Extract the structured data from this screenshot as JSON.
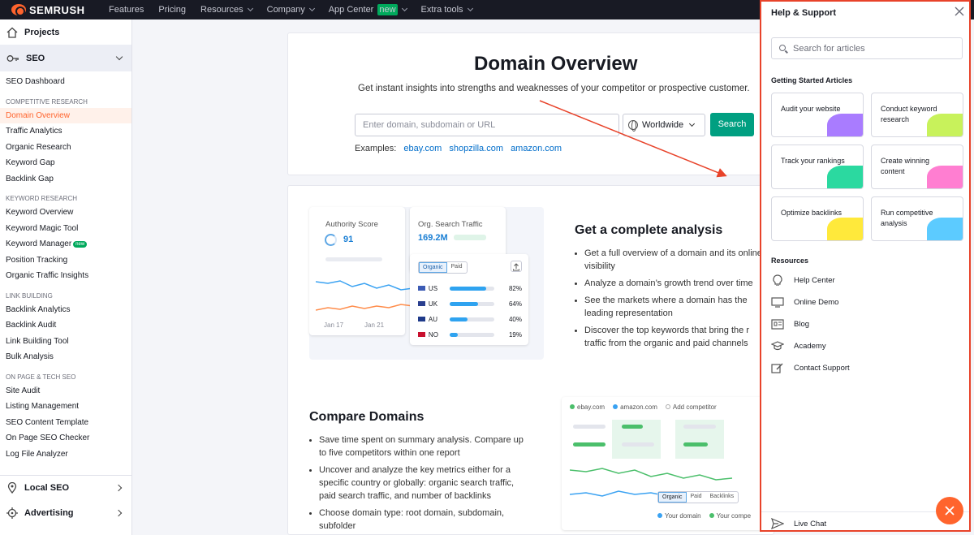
{
  "topbar": {
    "logo": "SEMRUSH",
    "nav": [
      {
        "label": "Features",
        "has_menu": false,
        "is_new": false
      },
      {
        "label": "Pricing",
        "has_menu": false,
        "is_new": false
      },
      {
        "label": "Resources",
        "has_menu": true,
        "is_new": false
      },
      {
        "label": "Company",
        "has_menu": true,
        "is_new": false
      },
      {
        "label": "App Center",
        "has_menu": true,
        "is_new": true
      },
      {
        "label": "Extra tools",
        "has_menu": true,
        "is_new": false
      }
    ],
    "new_badge": "new"
  },
  "sidebar": {
    "projects": "Projects",
    "seo": "SEO",
    "dashboard": "SEO Dashboard",
    "sections": [
      {
        "title": "COMPETITIVE RESEARCH",
        "items": [
          "Domain Overview",
          "Traffic Analytics",
          "Organic Research",
          "Keyword Gap",
          "Backlink Gap"
        ]
      },
      {
        "title": "KEYWORD RESEARCH",
        "items": [
          "Keyword Overview",
          "Keyword Magic Tool",
          "Keyword Manager",
          "Position Tracking",
          "Organic Traffic Insights"
        ]
      },
      {
        "title": "LINK BUILDING",
        "items": [
          "Backlink Analytics",
          "Backlink Audit",
          "Link Building Tool",
          "Bulk Analysis"
        ]
      },
      {
        "title": "ON PAGE & TECH SEO",
        "items": [
          "Site Audit",
          "Listing Management",
          "SEO Content Template",
          "On Page SEO Checker",
          "Log File Analyzer"
        ]
      }
    ],
    "new_badge": "new",
    "local_seo": "Local SEO",
    "advertising": "Advertising"
  },
  "hero": {
    "title": "Domain Overview",
    "subtitle": "Get instant insights into strengths and weaknesses of your competitor or prospective customer.",
    "placeholder": "Enter domain, subdomain or URL",
    "region": "Worldwide",
    "search": "Search",
    "examples_label": "Examples:",
    "examples": [
      "ebay.com",
      "shopzilla.com",
      "amazon.com"
    ]
  },
  "illustration": {
    "authority_label": "Authority Score",
    "authority_value": "91",
    "traffic_label": "Org. Search Traffic",
    "traffic_value": "169.2M",
    "dates": [
      "Jan 17",
      "Jan 21"
    ],
    "tabs": [
      "Organic",
      "Paid"
    ],
    "countries": [
      {
        "code": "US",
        "pct": "82%",
        "value": 82
      },
      {
        "code": "UK",
        "pct": "64%",
        "value": 64
      },
      {
        "code": "AU",
        "pct": "40%",
        "value": 40
      },
      {
        "code": "NO",
        "pct": "19%",
        "value": 19
      }
    ]
  },
  "analysis": {
    "title": "Get a complete analysis",
    "bullets": [
      "Get a full overview of a domain and its online visibility",
      "Analyze a domain’s growth trend over time",
      "See the markets where a domain has the leading representation",
      "Discover the top keywords that bring the r traffic from the organic and paid channels"
    ]
  },
  "compare": {
    "title": "Compare Domains",
    "bullets": [
      "Save time spent on summary analysis. Compare up to five competitors within one report",
      "Uncover and analyze the key metrics either for a specific country or globally: organic search traffic, paid search traffic, and number of backlinks",
      "Choose domain type: root domain, subdomain, subfolder"
    ],
    "legend": [
      "ebay.com",
      "amazon.com",
      "Add competitor"
    ],
    "tabs": [
      "Organic",
      "Paid",
      "Backlinks"
    ],
    "bottom_legend": [
      "Your domain",
      "Your compe"
    ]
  },
  "help": {
    "title": "Help & Support",
    "search_placeholder": "Search for articles",
    "getting_started": "Getting Started Articles",
    "cards": [
      {
        "label": "Audit your website",
        "color": "#a97cff"
      },
      {
        "label": "Conduct keyword research",
        "color": "#c8f25b"
      },
      {
        "label": "Track your rankings",
        "color": "#2bd9a0"
      },
      {
        "label": "Create winning content",
        "color": "#ff7ed1"
      },
      {
        "label": "Optimize backlinks",
        "color": "#ffe93b"
      },
      {
        "label": "Run competitive analysis",
        "color": "#5ccbff"
      }
    ],
    "resources_title": "Resources",
    "resources": [
      {
        "label": "Help Center",
        "icon": "lightbulb-icon"
      },
      {
        "label": "Online Demo",
        "icon": "monitor-icon"
      },
      {
        "label": "Blog",
        "icon": "newspaper-icon"
      },
      {
        "label": "Academy",
        "icon": "graduation-cap-icon"
      },
      {
        "label": "Contact Support",
        "icon": "edit-icon"
      }
    ],
    "live_chat": "Live Chat",
    "close_icon": "close-icon",
    "fab_icon": "close-icon"
  },
  "colors": {
    "accent": "#ff642d",
    "highlight_border": "#e8432a",
    "search_button": "#009f81",
    "link": "#006dca"
  }
}
